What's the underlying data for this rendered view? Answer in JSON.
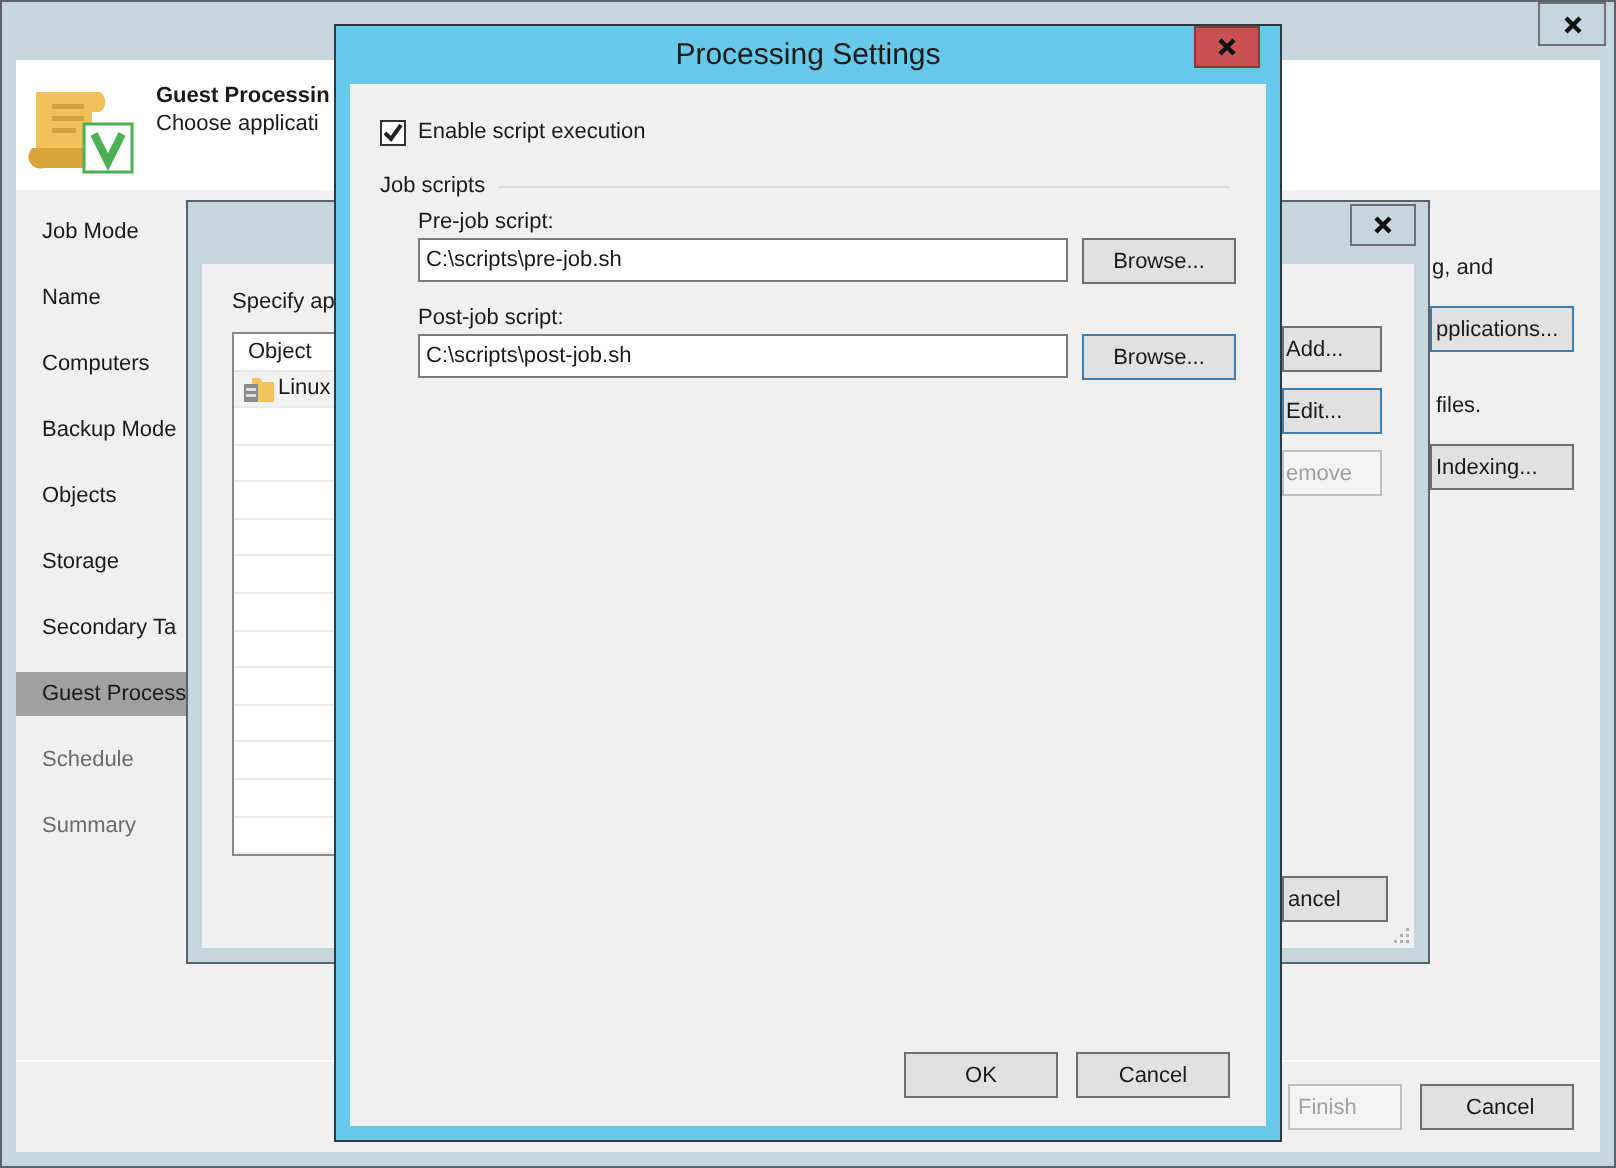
{
  "main_window": {
    "header": {
      "title": "Guest Processin",
      "subtitle": "Choose applicati"
    },
    "steps": [
      {
        "label": "Job Mode",
        "selected": false,
        "disabled": false
      },
      {
        "label": "Name",
        "selected": false,
        "disabled": false
      },
      {
        "label": "Computers",
        "selected": false,
        "disabled": false
      },
      {
        "label": "Backup Mode",
        "selected": false,
        "disabled": false
      },
      {
        "label": "Objects",
        "selected": false,
        "disabled": false
      },
      {
        "label": "Storage",
        "selected": false,
        "disabled": false
      },
      {
        "label": "Secondary Ta",
        "selected": false,
        "disabled": false
      },
      {
        "label": "Guest Process",
        "selected": true,
        "disabled": false
      },
      {
        "label": "Schedule",
        "selected": false,
        "disabled": true
      },
      {
        "label": "Summary",
        "selected": false,
        "disabled": true
      }
    ],
    "content": [
      {
        "kind": "text",
        "text": "g, and"
      },
      {
        "kind": "button",
        "text": "pplications...",
        "focused": true,
        "disabled": false
      },
      {
        "kind": "text",
        "text": "files."
      },
      {
        "kind": "button",
        "text": "Indexing...",
        "focused": false,
        "disabled": false
      }
    ],
    "footer_buttons": [
      {
        "label": "Finish",
        "disabled": true
      },
      {
        "label": "Cancel",
        "disabled": false
      }
    ]
  },
  "objects_dialog": {
    "prompt": "Specify ap",
    "columns": [
      "Object"
    ],
    "rows": [
      "Linux"
    ],
    "side_buttons": [
      {
        "label": "Add...",
        "focused": false,
        "disabled": false
      },
      {
        "label": "Edit...",
        "focused": true,
        "disabled": false
      },
      {
        "label": "emove",
        "focused": false,
        "disabled": true
      }
    ],
    "bottom_button": {
      "label": "ancel"
    }
  },
  "processing_settings": {
    "title": "Processing Settings",
    "enable_scripts": {
      "label": "Enable script execution",
      "checked": true
    },
    "group_title": "Job scripts",
    "scripts": [
      {
        "label": "Pre-job script:",
        "value": "C:\\scripts\\pre-job.sh",
        "button": "Browse...",
        "focused": false
      },
      {
        "label": "Post-job script:",
        "value": "C:\\scripts\\post-job.sh",
        "button": "Browse...",
        "focused": true
      }
    ],
    "buttons": [
      {
        "label": "OK"
      },
      {
        "label": "Cancel"
      }
    ]
  }
}
